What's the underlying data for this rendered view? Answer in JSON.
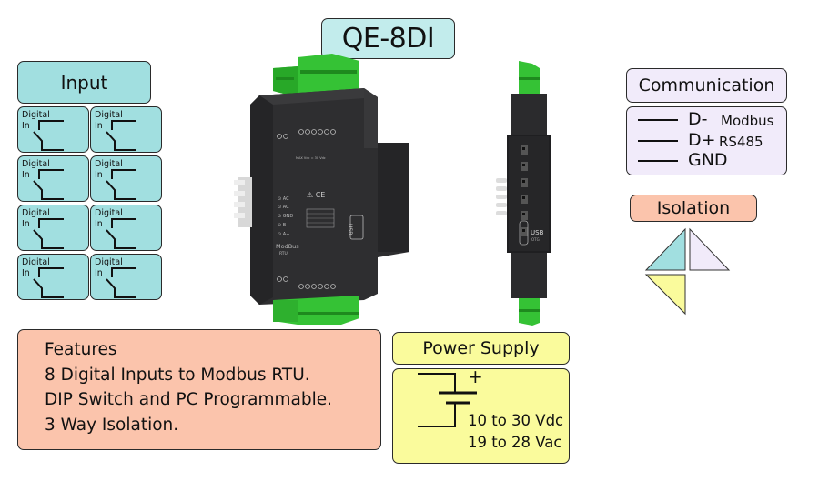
{
  "product": {
    "title": "QE-8DI"
  },
  "input": {
    "header": "Input",
    "channels": [
      {
        "label_line1": "Digital",
        "label_line2": "In",
        "icon": "switch-symbol-icon"
      },
      {
        "label_line1": "Digital",
        "label_line2": "In",
        "icon": "switch-symbol-icon"
      },
      {
        "label_line1": "Digital",
        "label_line2": "In",
        "icon": "switch-symbol-icon"
      },
      {
        "label_line1": "Digital",
        "label_line2": "In",
        "icon": "switch-symbol-icon"
      },
      {
        "label_line1": "Digital",
        "label_line2": "In",
        "icon": "switch-symbol-icon"
      },
      {
        "label_line1": "Digital",
        "label_line2": "In",
        "icon": "switch-symbol-icon"
      },
      {
        "label_line1": "Digital",
        "label_line2": "In",
        "icon": "switch-symbol-icon"
      },
      {
        "label_line1": "Digital",
        "label_line2": "In",
        "icon": "switch-symbol-icon"
      }
    ]
  },
  "communication": {
    "header": "Communication",
    "terminals": [
      "D-",
      "D+",
      "GND"
    ],
    "protocol_line1": "Modbus",
    "protocol_line2": "RS485"
  },
  "isolation": {
    "header": "Isolation",
    "icon": "three-way-isolation-triangles-icon",
    "colors": [
      "#a1dfe0",
      "#f1ebfa",
      "#fafb9c"
    ]
  },
  "features": {
    "header": "Features",
    "items": [
      "8 Digital Inputs to Modbus RTU.",
      "DIP Switch and PC Programmable.",
      "3 Way Isolation."
    ]
  },
  "power_supply": {
    "header": "Power Supply",
    "polarity": "+",
    "dc_range": "10 to 30 Vdc",
    "ac_range": "19 to 28 Vac",
    "icon": "battery-symbol-icon"
  },
  "device": {
    "front_labels": {
      "modbus": "ModBus",
      "rtu": "RTU",
      "usb": "USB",
      "otg": "OTG",
      "power": "MAX Vdc = 30 Vdc",
      "terminals": [
        "AC",
        "AC",
        "GND",
        "B-",
        "A+"
      ]
    },
    "side_labels": {
      "usb": "USB",
      "otg": "OTG",
      "model": "QE-8DI"
    }
  },
  "colors": {
    "teal": "#a1dfe0",
    "lavender": "#f1ebfa",
    "salmon": "#fbc4ac",
    "yellow": "#fafb9c",
    "terminal_green": "#2ec02e",
    "device_body": "#2b2b2d"
  }
}
